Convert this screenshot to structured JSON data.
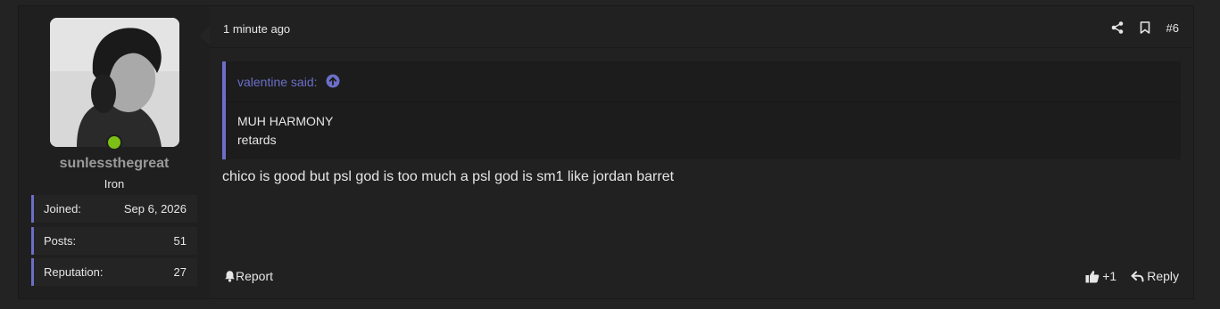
{
  "user": {
    "name": "sunlessthegreat",
    "title": "Iron",
    "online_color": "#7cbf16",
    "stats": [
      {
        "label": "Joined:",
        "value": "Sep 6, 2026"
      },
      {
        "label": "Posts:",
        "value": "51"
      },
      {
        "label": "Reputation:",
        "value": "27"
      }
    ]
  },
  "post": {
    "timestamp": "1 minute ago",
    "number": "#6",
    "icons": [
      "share-icon",
      "bookmark-icon"
    ],
    "quote": {
      "author": "valentine said:",
      "lines": [
        "MUH HARMONY",
        "retards"
      ]
    },
    "message": "chico is good but psl god is too much a psl god is sm1 like jordan barret",
    "actions": {
      "report": "Report",
      "like": "+1",
      "reply": "Reply"
    }
  },
  "colors": {
    "accent": "#6b6fc9",
    "background": "#232323",
    "panel": "#1e1e1e"
  }
}
